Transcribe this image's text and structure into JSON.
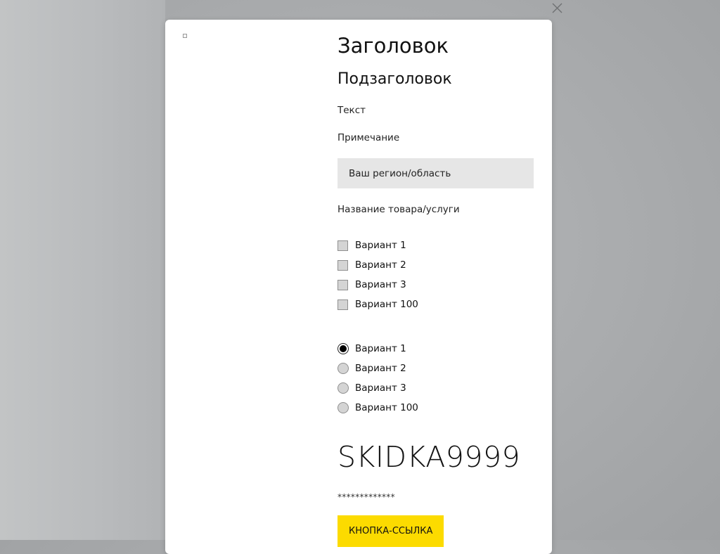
{
  "overlay": {
    "close_icon": "close-icon",
    "backdrop_color": "#a9abad"
  },
  "modal": {
    "title": "Заголовок",
    "subtitle": "Подзаголовок",
    "text": "Текст",
    "note": "Примечание",
    "region_field": {
      "value": "Ваш регион/область"
    },
    "product_label": "Название товара/услуги",
    "checkbox_options": [
      {
        "label": "Вариант 1",
        "checked": false
      },
      {
        "label": "Вариант 2",
        "checked": false
      },
      {
        "label": "Вариант 3",
        "checked": false
      },
      {
        "label": "Вариант 100",
        "checked": false
      }
    ],
    "radio_options": [
      {
        "label": "Вариант 1",
        "selected": true
      },
      {
        "label": "Вариант 2",
        "selected": false
      },
      {
        "label": "Вариант 3",
        "selected": false
      },
      {
        "label": "Вариант 100",
        "selected": false
      }
    ],
    "promo_code": "SKIDKA9999",
    "masked_text": "*************",
    "button_label": "КНОПКА-ССЫЛКА",
    "button_color": "#fcdb00"
  }
}
